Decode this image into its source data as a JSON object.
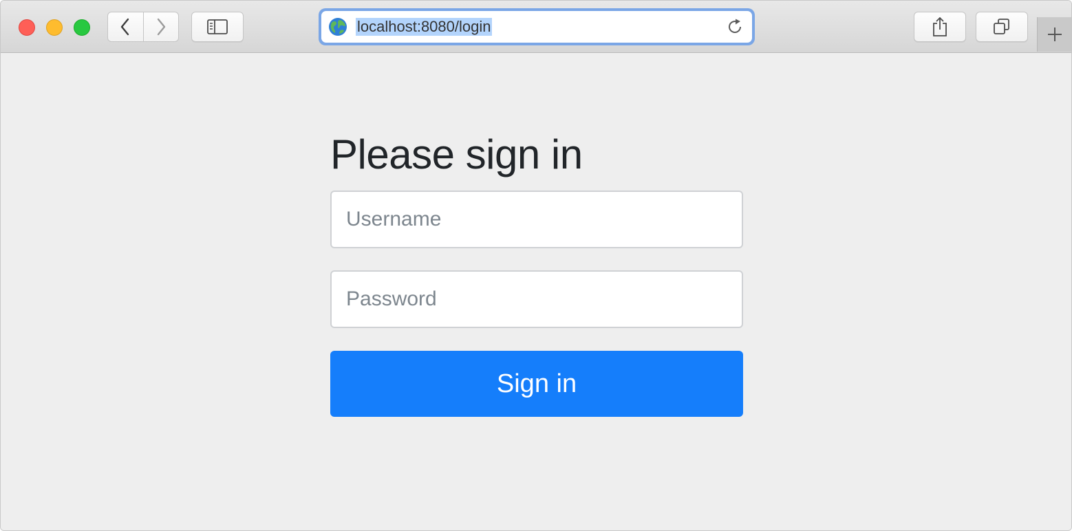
{
  "browser": {
    "url": "localhost:8080/login",
    "icons": {
      "back": "chevron-left-icon",
      "forward": "chevron-right-icon",
      "sidebar": "sidebar-icon",
      "share": "share-icon",
      "tabs": "tabs-icon",
      "reload": "reload-icon",
      "globe": "globe-icon",
      "new_tab": "plus-icon"
    },
    "colors": {
      "close": "#fe5f57",
      "minimize": "#febc2e",
      "maximize": "#28c840",
      "url_focus_ring": "#7aa6e6",
      "url_selection": "#b3d4fc"
    }
  },
  "login": {
    "heading": "Please sign in",
    "username_placeholder": "Username",
    "username_value": "",
    "password_placeholder": "Password",
    "password_value": "",
    "submit_label": "Sign in",
    "colors": {
      "background": "#eeeeee",
      "button": "#157efb",
      "heading": "#212529"
    }
  }
}
